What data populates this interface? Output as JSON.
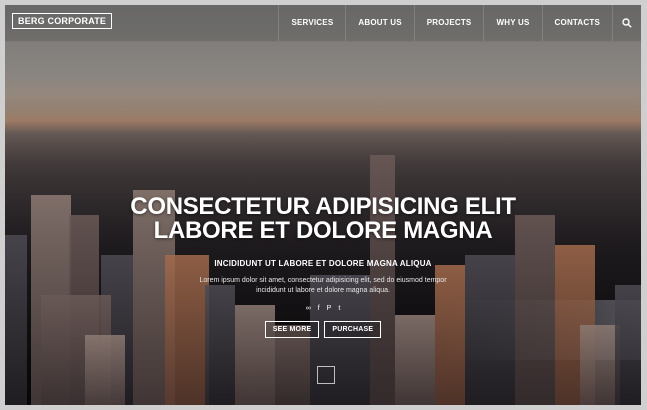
{
  "logo": "BERG CORPORATE",
  "nav": {
    "items": [
      {
        "label": "SERVICES"
      },
      {
        "label": "ABOUT US"
      },
      {
        "label": "PROJECTS"
      },
      {
        "label": "WHY US"
      },
      {
        "label": "CONTACTS"
      }
    ],
    "search_icon": "search-icon"
  },
  "hero": {
    "title_line1": "CONSECTETUR ADIPISICING ELIT",
    "title_line2": "LABORE ET DOLORE MAGNA",
    "subtitle": "INCIDIDUNT UT LABORE ET DOLORE MAGNA ALIQUA",
    "desc_line1": "Lorem ipsum dolor sit amet, consectetur adipisicing elit, sed do eiusmod tempor",
    "desc_line2": "incididunt ut labore et dolore magna aliqua.",
    "social": [
      "∞",
      "f",
      "P",
      "t"
    ],
    "buttons": {
      "see_more": "SEE MORE",
      "purchase": "PURCHASE"
    }
  },
  "colors": {
    "text": "#ffffff",
    "sky": "#7a7876",
    "city_dark": "#2a2527"
  }
}
